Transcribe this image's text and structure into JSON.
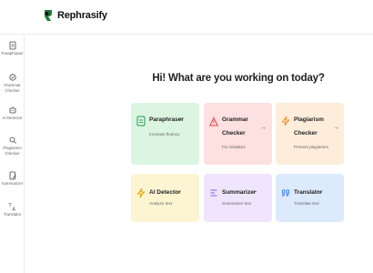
{
  "app": {
    "name": "Rephrasify"
  },
  "sidebar": {
    "items": [
      {
        "label": "Paraphraser"
      },
      {
        "label": "Grammar Checker"
      },
      {
        "label": "AI Detector"
      },
      {
        "label": "Plagiarism Checker"
      },
      {
        "label": "Summarizer"
      },
      {
        "label": "Translator"
      }
    ]
  },
  "main": {
    "heading": "Hi! What are you working on today?",
    "cards": [
      {
        "title": "Paraphraser",
        "subtitle": "Increase fluency",
        "arrow": "→",
        "color": "#dcf5e1"
      },
      {
        "title_line1": "Grammar",
        "title_line2": "Checker",
        "subtitle": "Fix mistakes",
        "arrow": "→",
        "color": "#fde0e0"
      },
      {
        "title_line1": "Plagiarism",
        "title_line2": "Checker",
        "subtitle": "Prevent plagiarism",
        "arrow": "→",
        "color": "#feeddb"
      },
      {
        "title": "AI Detector",
        "subtitle": "Analyze text",
        "arrow": "→",
        "color": "#fdf5d2"
      },
      {
        "title": "Summarizer",
        "subtitle": "Summarize text",
        "arrow": "→",
        "color": "#efe5fc"
      },
      {
        "title": "Translator",
        "subtitle": "Translate text",
        "arrow": "→",
        "color": "#ddeafc"
      }
    ]
  },
  "icons": {
    "logo": "rephrasify-logo-icon",
    "paraphraser": "document-icon",
    "grammar": "warning-triangle-icon",
    "plagiarism": "lightning-icon",
    "ai_detector": "lightning-icon",
    "summarizer": "list-lines-icon",
    "translator": "quote-icon"
  }
}
